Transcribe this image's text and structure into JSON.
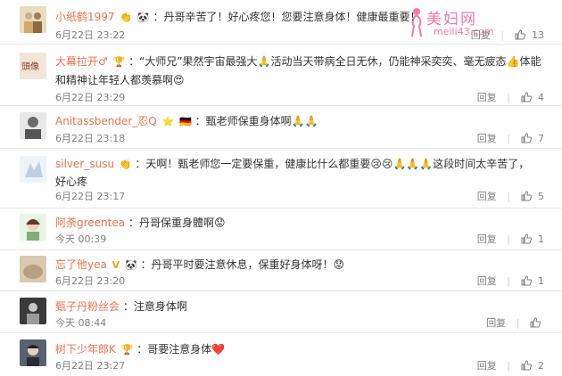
{
  "watermark": {
    "title": "美妇网",
    "url": "meili43.com"
  },
  "ui": {
    "reply_label": "回复"
  },
  "comments": [
    {
      "name": "小纸鹤1997",
      "badges": [
        "👏",
        "🐼"
      ],
      "text_line1": "：丹哥辛苦了！好心疼您！您要注意身体！健康最重要！",
      "text_line2": "",
      "time": "6月22日 23:22",
      "likes": "13",
      "avatar_color": "#c9b28a"
    },
    {
      "name": "大幕拉开♂",
      "badges": [
        "🏆"
      ],
      "text_line1": "：“大师兄”果然宇宙最强大🙏活动当天带病全日无休，仍能神采奕奕、毫无疲态👍体能",
      "text_line2": "和精神让年轻人都羡慕啊😍",
      "time": "6月22日 23:29",
      "likes": "4",
      "avatar_color": "#8b5a3c"
    },
    {
      "name": "Anitassbender_忍Q",
      "badges": [
        "⭐",
        "🇩🇪"
      ],
      "text_line1": "：甄老师保重身体啊🙏🙏",
      "text_line2": "",
      "time": "6月22日 23:18",
      "likes": "7",
      "avatar_color": "#6b6b6b"
    },
    {
      "name": "silver_susu",
      "badges": [
        "👏"
      ],
      "text_line1": "：天啊！甄老师您一定要保重，健康比什么都重要😢😢🙏🙏🙏这段时间太辛苦了，",
      "text_line2": "好心疼",
      "time": "6月22日 23:17",
      "likes": "5",
      "avatar_color": "#bfcfe0"
    },
    {
      "name": "阿荼greentea",
      "badges": [],
      "text_line1": "：丹哥保重身體啊😟",
      "text_line2": "",
      "time": "今天 00:39",
      "likes": "1",
      "avatar_color": "#7fae7a"
    },
    {
      "name": "忘了他yea",
      "badges": [
        "V",
        "🐼"
      ],
      "text_line1": "：丹哥平时要注意休息，保重好身体呀！😟",
      "text_line2": "",
      "time": "6月22日 23:20",
      "likes": "1",
      "avatar_color": "#d8c9b0"
    },
    {
      "name": "甄子丹粉丝会",
      "badges": [],
      "text_line1": "：注意身体啊",
      "text_line2": "",
      "time": "今天 08:44",
      "likes": "",
      "avatar_color": "#3a3a3a"
    },
    {
      "name": "树下少年郎K",
      "badges": [
        "🏆"
      ],
      "text_line1": "：哥要注意身体❤️",
      "text_line2": "",
      "time": "6月22日 23:27",
      "likes": "2",
      "avatar_color": "#4a4a55"
    }
  ]
}
